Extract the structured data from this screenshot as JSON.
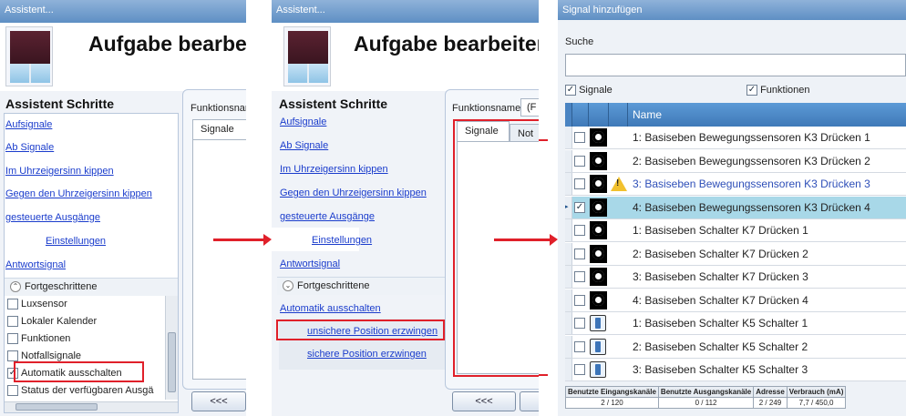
{
  "win1": {
    "title": "Assistent...",
    "header_title": "Aufgabe bearbei",
    "steps_title": "Assistent Schritte",
    "steps": [
      "Aufsignale",
      "Ab Signale",
      "Im Uhrzeigersinn kippen",
      "Gegen den Uhrzeigersinn kippen",
      "gesteuerte Ausgänge",
      "Einstellungen",
      "Antwortsignal"
    ],
    "advanced_label": "Fortgeschrittene",
    "advanced_items": [
      {
        "label": "Luxsensor",
        "checked": false
      },
      {
        "label": "Lokaler Kalender",
        "checked": false
      },
      {
        "label": "Funktionen",
        "checked": false
      },
      {
        "label": "Notfallsignale",
        "checked": false
      },
      {
        "label": "Automatik ausschalten",
        "checked": true
      },
      {
        "label": "Status der verfügbaren Ausgä",
        "checked": false
      }
    ],
    "function_name_label": "Funktionsnar",
    "tab_signals": "Signale",
    "back_button": "<<<"
  },
  "win2": {
    "title": "Assistent...",
    "header_title": "Aufgabe bearbeiten",
    "steps_title": "Assistent Schritte",
    "steps": [
      "Aufsignale",
      "Ab Signale",
      "Im Uhrzeigersinn kippen",
      "Gegen den Uhrzeigersinn kippen",
      "gesteuerte Ausgänge",
      "Einstellungen",
      "Antwortsignal"
    ],
    "advanced_label": "Fortgeschrittene",
    "advanced_links": [
      "Automatik ausschalten",
      "unsichere Position erzwingen",
      "sichere Position erzwingen"
    ],
    "function_name_label": "Funktionsname",
    "function_name_value": "(F",
    "tab_signals": "Signale",
    "tab_notify": "Not",
    "back_button": "<<<"
  },
  "win3": {
    "title": "Signal hinzufügen",
    "search_label": "Suche",
    "search_value": "",
    "filter_signals": "Signale",
    "filter_functions": "Funktionen",
    "column_name": "Name",
    "rows": [
      {
        "name": "1: Basiseben Bewegungssensoren K3 Drücken 1",
        "icon": "sensor-icon",
        "checked": false,
        "warning": false,
        "selected": false
      },
      {
        "name": "2: Basiseben Bewegungssensoren K3 Drücken 2",
        "icon": "sensor-icon",
        "checked": false,
        "warning": false,
        "selected": false
      },
      {
        "name": "3: Basiseben Bewegungssensoren K3 Drücken 3",
        "icon": "sensor-icon",
        "checked": false,
        "warning": true,
        "selected": false
      },
      {
        "name": "4: Basiseben Bewegungssensoren K3 Drücken 4",
        "icon": "sensor-icon",
        "checked": true,
        "warning": false,
        "selected": true
      },
      {
        "name": "1: Basiseben Schalter K7 Drücken 1",
        "icon": "sensor-icon",
        "checked": false,
        "warning": false,
        "selected": false
      },
      {
        "name": "2: Basiseben Schalter K7 Drücken 2",
        "icon": "sensor-icon",
        "checked": false,
        "warning": false,
        "selected": false
      },
      {
        "name": "3: Basiseben Schalter K7 Drücken 3",
        "icon": "sensor-icon",
        "checked": false,
        "warning": false,
        "selected": false
      },
      {
        "name": "4: Basiseben Schalter K7 Drücken 4",
        "icon": "sensor-icon",
        "checked": false,
        "warning": false,
        "selected": false
      },
      {
        "name": "1: Basiseben Schalter K5 Schalter 1",
        "icon": "switch-icon",
        "checked": false,
        "warning": false,
        "selected": false
      },
      {
        "name": "2: Basiseben Schalter K5 Schalter 2",
        "icon": "switch-icon",
        "checked": false,
        "warning": false,
        "selected": false
      },
      {
        "name": "3: Basiseben Schalter K5 Schalter 3",
        "icon": "switch-icon",
        "checked": false,
        "warning": false,
        "selected": false
      }
    ],
    "stats": {
      "headers": [
        "Benutzte Eingangskanäle",
        "Benutzte Ausgangskanäle",
        "Adresse",
        "Verbrauch (mA)"
      ],
      "values": [
        "2 / 120",
        "0 / 112",
        "2 / 249",
        "7,7 / 450,0"
      ]
    },
    "colors": {
      "selected_row": "#a8d8e8",
      "header": "#3f79b8",
      "highlight_box": "#e0202a"
    }
  }
}
